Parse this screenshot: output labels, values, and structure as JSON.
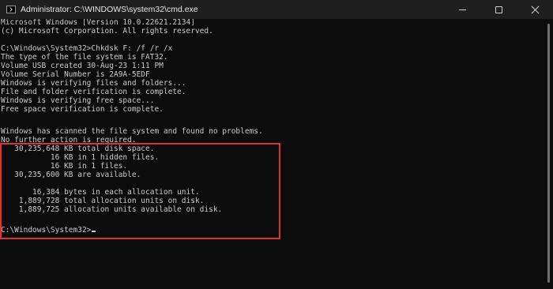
{
  "window": {
    "title": "Administrator: C:\\WINDOWS\\system32\\cmd.exe",
    "icon": "terminal-icon",
    "controls": [
      "minimize-icon",
      "maximize-icon",
      "close-icon"
    ]
  },
  "console": {
    "lines": [
      "Microsoft Windows [Version 10.0.22621.2134]",
      "(c) Microsoft Corporation. All rights reserved.",
      "",
      "C:\\Windows\\System32>Chkdsk F: /f /r /x",
      "The type of the file system is FAT32.",
      "Volume USB created 30-Aug-23 1:11 PM",
      "Volume Serial Number is 2A9A-5EDF",
      "Windows is verifying files and folders...",
      "File and folder verification is complete.",
      "Windows is verifying free space...",
      "Free space verification is complete.",
      "",
      "Windows has scanned the file system and found no problems.",
      "No further action is required.",
      "   30,235,648 KB total disk space.",
      "           16 KB in 1 hidden files.",
      "           16 KB in 1 files.",
      "   30,235,600 KB are available.",
      "",
      "       16,384 bytes in each allocation unit.",
      "    1,889,728 total allocation units on disk.",
      "    1,889,725 allocation units available on disk.",
      "",
      "C:\\Windows\\System32>"
    ],
    "text_color": "#cccccc",
    "background": "#0c0c0c",
    "highlight_color": "#e0313a"
  }
}
